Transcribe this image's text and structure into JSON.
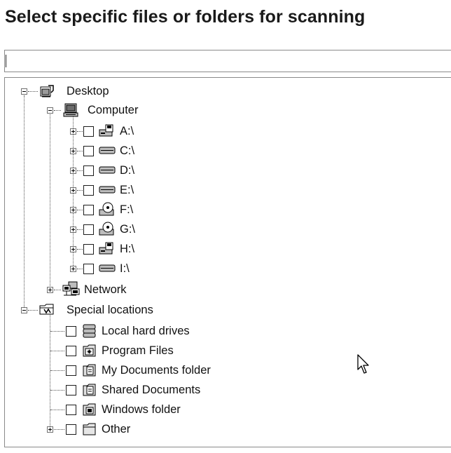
{
  "dialog": {
    "title": "Select specific files or folders for scanning",
    "path_value": ""
  },
  "tree": {
    "desktop": {
      "label": "Desktop",
      "computer": {
        "label": "Computer",
        "drives": [
          {
            "label": "A:\\",
            "icon": "floppy-drive-icon"
          },
          {
            "label": "C:\\",
            "icon": "hard-drive-icon"
          },
          {
            "label": "D:\\",
            "icon": "hard-drive-icon"
          },
          {
            "label": "E:\\",
            "icon": "hard-drive-icon"
          },
          {
            "label": "F:\\",
            "icon": "cd-drive-icon"
          },
          {
            "label": "G:\\",
            "icon": "cd-drive-icon"
          },
          {
            "label": "H:\\",
            "icon": "floppy-drive-icon"
          },
          {
            "label": "I:\\",
            "icon": "hard-drive-icon"
          }
        ]
      },
      "network": {
        "label": "Network"
      }
    },
    "special": {
      "label": "Special locations",
      "items": [
        {
          "label": "Local hard drives",
          "icon": "hard-drives-icon"
        },
        {
          "label": "Program Files",
          "icon": "program-files-icon"
        },
        {
          "label": "My Documents folder",
          "icon": "documents-folder-icon"
        },
        {
          "label": "Shared Documents",
          "icon": "documents-folder-icon"
        },
        {
          "label": "Windows folder",
          "icon": "windows-folder-icon"
        },
        {
          "label": "Other",
          "icon": "folder-icon"
        }
      ]
    }
  }
}
